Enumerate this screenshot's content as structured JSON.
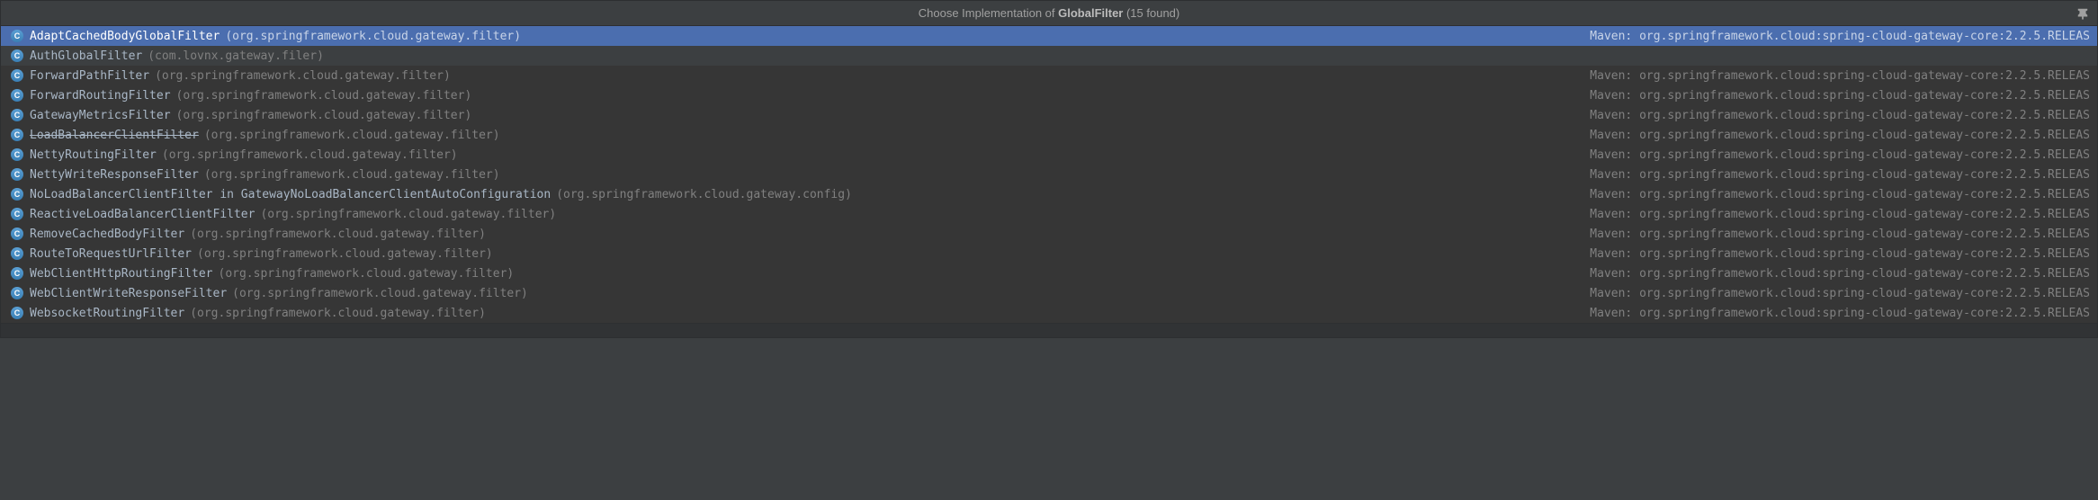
{
  "title": {
    "prefix": "Choose Implementation of ",
    "name": "GlobalFilter",
    "suffix": " (15 found)"
  },
  "items": [
    {
      "name": "AdaptCachedBodyGlobalFilter",
      "pkg": "(org.springframework.cloud.gateway.filter)",
      "loc": "Maven: org.springframework.cloud:spring-cloud-gateway-core:2.2.5.RELEAS",
      "selected": true,
      "deprecated": false,
      "group": "top"
    },
    {
      "name": "AuthGlobalFilter",
      "pkg": "(com.lovnx.gateway.filer)",
      "loc": "",
      "selected": false,
      "deprecated": false,
      "group": "top"
    },
    {
      "name": "ForwardPathFilter",
      "pkg": "(org.springframework.cloud.gateway.filter)",
      "loc": "Maven: org.springframework.cloud:spring-cloud-gateway-core:2.2.5.RELEAS",
      "selected": false,
      "deprecated": false,
      "group": "rest"
    },
    {
      "name": "ForwardRoutingFilter",
      "pkg": "(org.springframework.cloud.gateway.filter)",
      "loc": "Maven: org.springframework.cloud:spring-cloud-gateway-core:2.2.5.RELEAS",
      "selected": false,
      "deprecated": false,
      "group": "rest"
    },
    {
      "name": "GatewayMetricsFilter",
      "pkg": "(org.springframework.cloud.gateway.filter)",
      "loc": "Maven: org.springframework.cloud:spring-cloud-gateway-core:2.2.5.RELEAS",
      "selected": false,
      "deprecated": false,
      "group": "rest"
    },
    {
      "name": "LoadBalancerClientFilter",
      "pkg": "(org.springframework.cloud.gateway.filter)",
      "loc": "Maven: org.springframework.cloud:spring-cloud-gateway-core:2.2.5.RELEAS",
      "selected": false,
      "deprecated": true,
      "group": "rest"
    },
    {
      "name": "NettyRoutingFilter",
      "pkg": "(org.springframework.cloud.gateway.filter)",
      "loc": "Maven: org.springframework.cloud:spring-cloud-gateway-core:2.2.5.RELEAS",
      "selected": false,
      "deprecated": false,
      "group": "rest"
    },
    {
      "name": "NettyWriteResponseFilter",
      "pkg": "(org.springframework.cloud.gateway.filter)",
      "loc": "Maven: org.springframework.cloud:spring-cloud-gateway-core:2.2.5.RELEAS",
      "selected": false,
      "deprecated": false,
      "group": "rest"
    },
    {
      "name": "NoLoadBalancerClientFilter in GatewayNoLoadBalancerClientAutoConfiguration",
      "pkg": "(org.springframework.cloud.gateway.config)",
      "loc": "Maven: org.springframework.cloud:spring-cloud-gateway-core:2.2.5.RELEAS",
      "selected": false,
      "deprecated": false,
      "group": "rest"
    },
    {
      "name": "ReactiveLoadBalancerClientFilter",
      "pkg": "(org.springframework.cloud.gateway.filter)",
      "loc": "Maven: org.springframework.cloud:spring-cloud-gateway-core:2.2.5.RELEAS",
      "selected": false,
      "deprecated": false,
      "group": "rest"
    },
    {
      "name": "RemoveCachedBodyFilter",
      "pkg": "(org.springframework.cloud.gateway.filter)",
      "loc": "Maven: org.springframework.cloud:spring-cloud-gateway-core:2.2.5.RELEAS",
      "selected": false,
      "deprecated": false,
      "group": "rest"
    },
    {
      "name": "RouteToRequestUrlFilter",
      "pkg": "(org.springframework.cloud.gateway.filter)",
      "loc": "Maven: org.springframework.cloud:spring-cloud-gateway-core:2.2.5.RELEAS",
      "selected": false,
      "deprecated": false,
      "group": "rest"
    },
    {
      "name": "WebClientHttpRoutingFilter",
      "pkg": "(org.springframework.cloud.gateway.filter)",
      "loc": "Maven: org.springframework.cloud:spring-cloud-gateway-core:2.2.5.RELEAS",
      "selected": false,
      "deprecated": false,
      "group": "rest"
    },
    {
      "name": "WebClientWriteResponseFilter",
      "pkg": "(org.springframework.cloud.gateway.filter)",
      "loc": "Maven: org.springframework.cloud:spring-cloud-gateway-core:2.2.5.RELEAS",
      "selected": false,
      "deprecated": false,
      "group": "rest"
    },
    {
      "name": "WebsocketRoutingFilter",
      "pkg": "(org.springframework.cloud.gateway.filter)",
      "loc": "Maven: org.springframework.cloud:spring-cloud-gateway-core:2.2.5.RELEAS",
      "selected": false,
      "deprecated": false,
      "group": "rest"
    }
  ],
  "icon_label": "C"
}
